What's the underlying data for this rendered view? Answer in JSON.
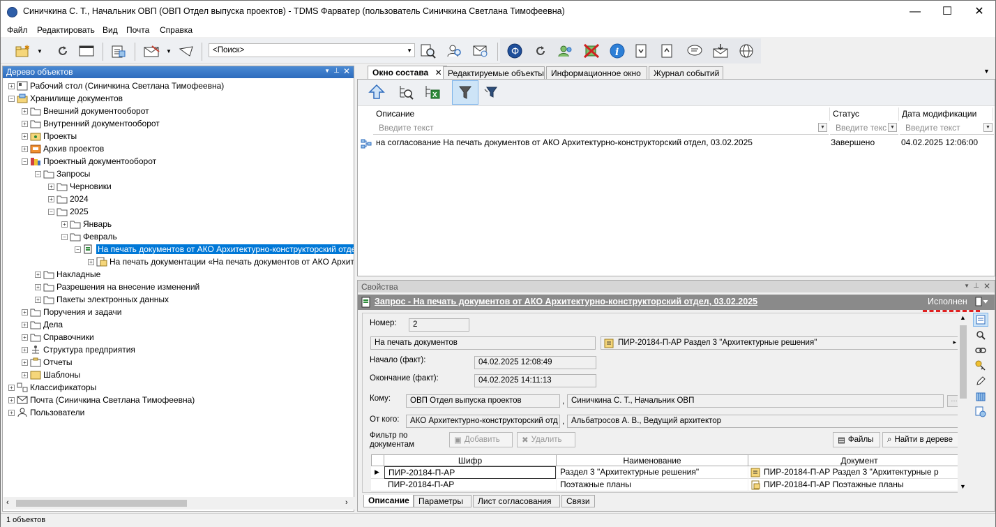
{
  "window": {
    "title": "Синичкина С. Т., Начальник ОВП (ОВП Отдел выпуска проектов) - TDMS Фарватер (пользователь Синичкина Светлана Тимофеевна)",
    "minimize": "—",
    "maximize": "☐",
    "close": "✕"
  },
  "menu": [
    "Файл",
    "Редактировать",
    "Вид",
    "Почта",
    "Справка"
  ],
  "toolbar": {
    "search_value": "<Поиск>"
  },
  "left_panel": {
    "title": "Дерево объектов",
    "tree": [
      {
        "label": "Рабочий стол (Синичкина Светлана Тимофеевна)",
        "expander": "+"
      },
      {
        "label": "Хранилище документов",
        "expander": "−"
      },
      {
        "label": "Внешний документооборот",
        "expander": "+"
      },
      {
        "label": "Внутренний документооборот",
        "expander": "+"
      },
      {
        "label": "Проекты",
        "expander": "+"
      },
      {
        "label": "Архив проектов",
        "expander": "+"
      },
      {
        "label": "Проектный документооборот",
        "expander": "−"
      },
      {
        "label": "Запросы",
        "expander": "−"
      },
      {
        "label": "Черновики",
        "expander": "+"
      },
      {
        "label": "2024",
        "expander": "+"
      },
      {
        "label": "2025",
        "expander": "−"
      },
      {
        "label": "Январь",
        "expander": "+"
      },
      {
        "label": "Февраль",
        "expander": "−"
      },
      {
        "label": "На печать документов от АКО Архитектурно-конструкторский отдел",
        "expander": "−"
      },
      {
        "label": "На печать документации «На печать документов от АКО Архит",
        "expander": "+"
      },
      {
        "label": "Накладные",
        "expander": "+"
      },
      {
        "label": "Разрешения на внесение изменений",
        "expander": "+"
      },
      {
        "label": "Пакеты электронных данных",
        "expander": "+"
      },
      {
        "label": "Поручения и задачи",
        "expander": "+"
      },
      {
        "label": "Дела",
        "expander": "+"
      },
      {
        "label": "Справочники",
        "expander": "+"
      },
      {
        "label": "Структура предприятия",
        "expander": "+"
      },
      {
        "label": "Отчеты",
        "expander": "+"
      },
      {
        "label": "Шаблоны",
        "expander": "+"
      },
      {
        "label": "Классификаторы",
        "expander": "+"
      },
      {
        "label": "Почта (Синичкина Светлана Тимофеевна)",
        "expander": "+"
      },
      {
        "label": "Пользователи",
        "expander": "+"
      }
    ]
  },
  "tabs": [
    "Окно состава",
    "Редактируемые объекты",
    "Информационное окно",
    "Журнал событий"
  ],
  "composite": {
    "columns": [
      "Описание",
      "Статус",
      "Дата модификации"
    ],
    "filter_placeholder": [
      "Введите текст",
      "Введите текс",
      "Введите текст"
    ],
    "rows": [
      {
        "description": "на согласование На печать документов от АКО Архитектурно-конструкторский отдел, 03.02.2025",
        "status": "Завершено",
        "modified": "04.02.2025 12:06:00"
      }
    ]
  },
  "properties": {
    "panel_title": "Свойства",
    "header_title": "Запрос - На печать документов от АКО Архитектурно-конструкторский отдел, 03.02.2025",
    "header_status": "Исполнен",
    "number_label": "Номер:",
    "number_value": "2",
    "type_value": "На печать документов",
    "ref_value": "ПИР-20184-П-АР Раздел 3 \"Архитектурные решения\"",
    "start_label": "Начало (факт):",
    "start_value": "04.02.2025 12:08:49",
    "end_label": "Окончание (факт):",
    "end_value": "04.02.2025 14:11:13",
    "to_label": "Кому:",
    "to_dept": "ОВП Отдел выпуска проектов",
    "to_person": "Синичкина С. Т., Начальник ОВП",
    "from_label": "От кого:",
    "from_dept": "АКО Архитектурно-конструкторский отд",
    "from_person": "Альбатросов А. В., Ведущий архитектор",
    "filter_label": "Фильтр по документам",
    "add_button": "Добавить",
    "delete_button": "Удалить",
    "files_button": "Файлы",
    "find_button": "Найти в дереве",
    "grid_columns": [
      "Шифр",
      "Наименование",
      "Документ"
    ],
    "grid_rows": [
      {
        "code": "ПИР-20184-П-АР",
        "name": "Раздел 3 \"Архитектурные решения\"",
        "doc": "ПИР-20184-П-АР Раздел 3 \"Архитектурные р"
      },
      {
        "code": "ПИР-20184-П-АР",
        "name": "Поэтажные планы",
        "doc": "ПИР-20184-П-АР Поэтажные планы"
      }
    ],
    "bottom_tabs": [
      "Описание",
      "Параметры",
      "Лист согласования",
      "Связи"
    ]
  },
  "status": {
    "text": "1 объектов"
  },
  "colors": {
    "accent": "#0078d7",
    "panel_header": "#2d6bbd",
    "props_header": "#8a8a8a",
    "marker_red": "#e02020"
  }
}
